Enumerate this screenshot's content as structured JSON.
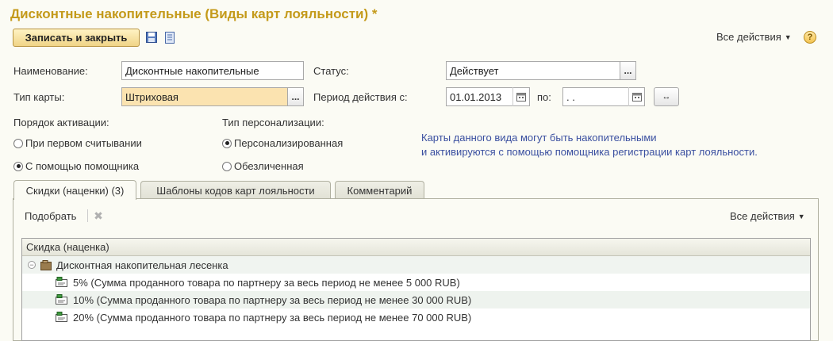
{
  "window": {
    "title": "Дисконтные накопительные (Виды карт лояльности) *"
  },
  "toolbar": {
    "save_close_label": "Записать и закрыть",
    "all_actions_label": "Все действия",
    "help_label": "?"
  },
  "form": {
    "name_label": "Наименование:",
    "name_value": "Дисконтные накопительные",
    "status_label": "Статус:",
    "status_value": "Действует",
    "card_type_label": "Тип карты:",
    "card_type_value": "Штриховая",
    "period_label": "Период действия с:",
    "period_from": "01.01.2013",
    "period_to_label": "по:",
    "period_to": ". .",
    "ellipsis": "...",
    "period_btn": "↔"
  },
  "activation": {
    "label": "Порядок активации:",
    "options": [
      {
        "label": "При первом считывании",
        "selected": false
      },
      {
        "label": "С помощью помощника",
        "selected": true
      }
    ]
  },
  "personalization": {
    "label": "Тип персонализации:",
    "options": [
      {
        "label": "Персонализированная",
        "selected": true
      },
      {
        "label": "Обезличенная",
        "selected": false
      }
    ]
  },
  "info": {
    "line1": "Карты данного вида могут быть накопительными",
    "line2": "и активируются с помощью помощника регистрации карт лояльности."
  },
  "tabs": [
    {
      "label": "Скидки (наценки) (3)",
      "active": true
    },
    {
      "label": "Шаблоны кодов карт лояльности",
      "active": false
    },
    {
      "label": "Комментарий",
      "active": false
    }
  ],
  "discounts_toolbar": {
    "pick_label": "Подобрать",
    "all_actions_label": "Все действия"
  },
  "grid": {
    "column_header": "Скидка (наценка)",
    "group": "Дисконтная накопительная лесенка",
    "rows": [
      "5% (Сумма проданного товара по партнеру за весь период не менее 5 000 RUB)",
      "10% (Сумма проданного товара по партнеру за весь период не менее 30 000 RUB)",
      "20% (Сумма проданного товара по партнеру за весь период не менее 70 000 RUB)"
    ]
  },
  "colors": {
    "title": "#c49a1a",
    "info_text": "#3a4fa0",
    "card_type_bg": "#fbe3b0"
  }
}
